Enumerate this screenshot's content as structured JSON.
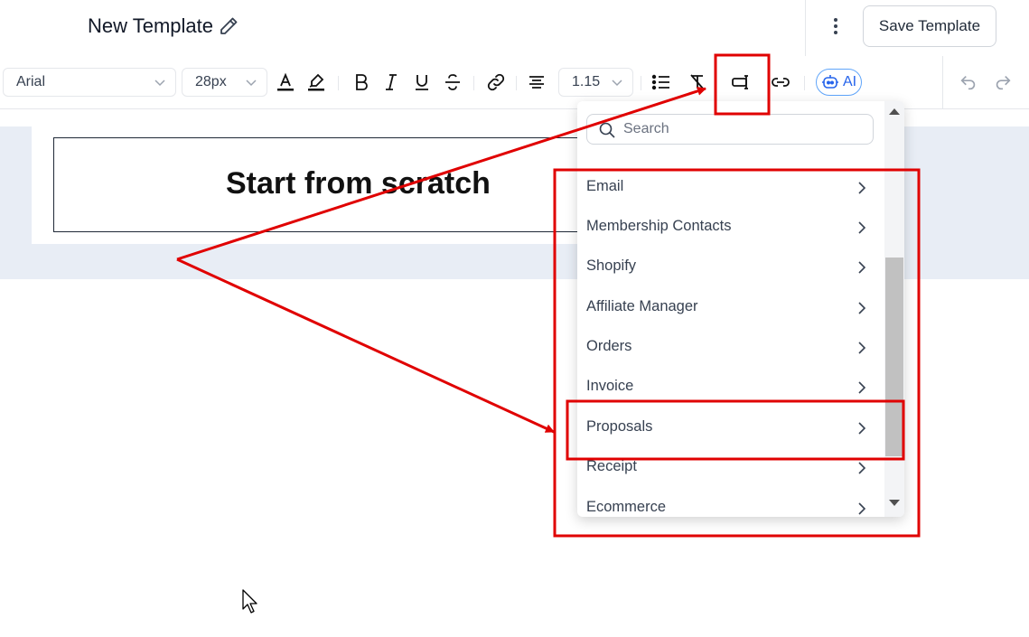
{
  "header": {
    "title": "New Template",
    "save_label": "Save Template"
  },
  "toolbar": {
    "font_family": "Arial",
    "font_size": "28px",
    "line_height": "1.15",
    "ai_label": "AI"
  },
  "canvas": {
    "heading": "Start from scratch"
  },
  "dropdown": {
    "search_placeholder": "Search",
    "items": [
      {
        "label": "Email"
      },
      {
        "label": "Membership Contacts"
      },
      {
        "label": "Shopify"
      },
      {
        "label": "Affiliate Manager"
      },
      {
        "label": "Orders"
      },
      {
        "label": "Invoice"
      },
      {
        "label": "Proposals"
      },
      {
        "label": "Receipt"
      },
      {
        "label": "Ecommerce"
      }
    ]
  },
  "annotation": {
    "color": "#e00000"
  },
  "colors": {
    "canvas_band": "#e8edf5",
    "ai_accent": "#2563eb"
  }
}
